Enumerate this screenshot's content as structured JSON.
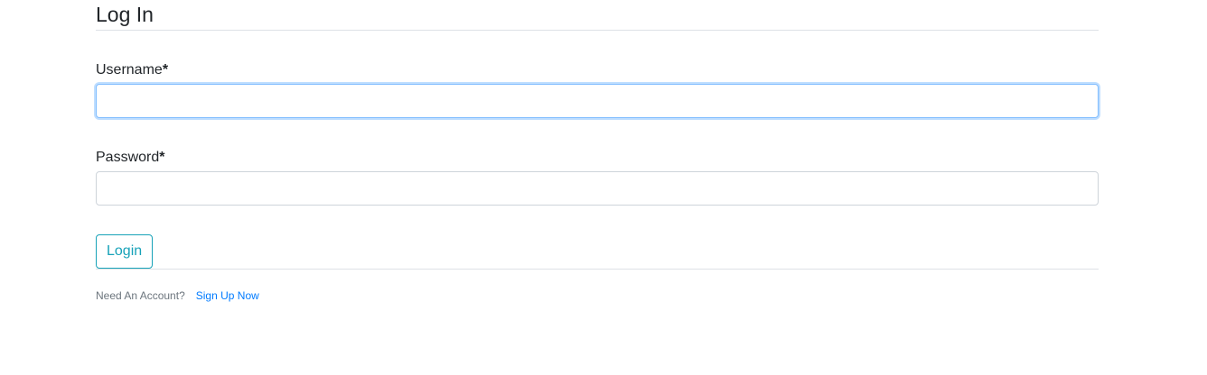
{
  "page": {
    "title": "Log In"
  },
  "form": {
    "username": {
      "label": "Username",
      "required_marker": "*",
      "value": "",
      "placeholder": "",
      "focused": true
    },
    "password": {
      "label": "Password",
      "required_marker": "*",
      "value": "",
      "placeholder": ""
    },
    "submit_label": "Login"
  },
  "footer": {
    "prompt": "Need An Account?",
    "link_label": "Sign Up Now"
  },
  "colors": {
    "text": "#212529",
    "rule": "#dee2e6",
    "input_border": "#ced4da",
    "focus_border": "#80bdff",
    "button_accent": "#17a2b8",
    "muted_text": "#6c757d",
    "link": "#007bff"
  }
}
